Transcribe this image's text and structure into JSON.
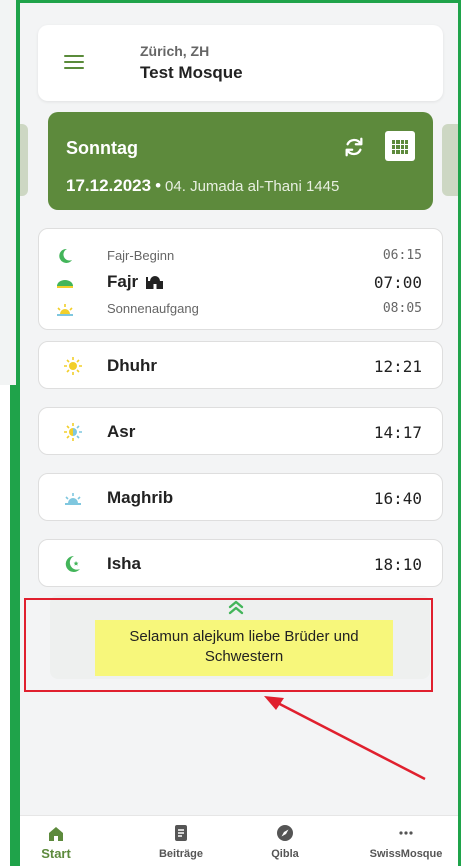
{
  "header": {
    "city": "Zürich, ZH",
    "mosque": "Test Mosque"
  },
  "date_card": {
    "day": "Sonntag",
    "gregorian": "17.12.2023",
    "separator": "•",
    "hijri": "04. Jumada al-Thani 1445"
  },
  "fajr": {
    "begin_label": "Fajr-Beginn",
    "begin_time": "06:15",
    "label": "Fajr",
    "time": "07:00",
    "sunrise_label": "Sonnenaufgang",
    "sunrise_time": "08:05"
  },
  "prayers": [
    {
      "name": "Dhuhr",
      "time": "12:21",
      "icon": "sun-icon"
    },
    {
      "name": "Asr",
      "time": "14:17",
      "icon": "sun-half-icon"
    },
    {
      "name": "Maghrib",
      "time": "16:40",
      "icon": "sunset-icon"
    },
    {
      "name": "Isha",
      "time": "18:10",
      "icon": "crescent-star-icon"
    }
  ],
  "announcement": {
    "line1": "Selamun alejkum liebe Brüder und",
    "line2": "Schwestern"
  },
  "nav": {
    "start": "Start",
    "posts": "Beiträge",
    "qibla": "Qibla",
    "more": "SwissMosque"
  },
  "colors": {
    "accent": "#5d8a3c",
    "highlight": "#f7f77b",
    "annotation_red": "#e0202e",
    "frame_green": "#1fa34a"
  }
}
